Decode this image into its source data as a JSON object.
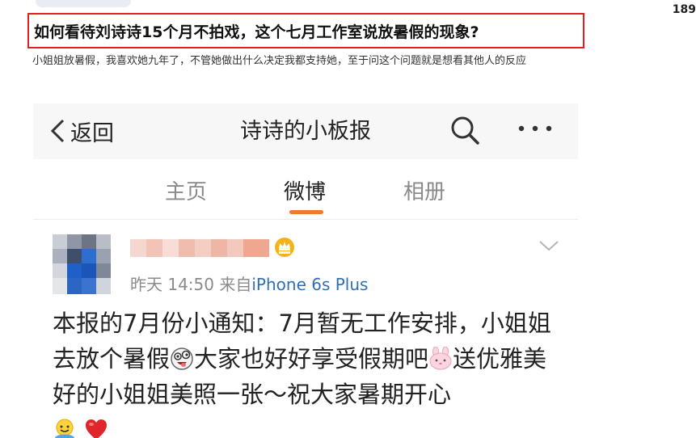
{
  "corner_count": "189",
  "question": {
    "title": "如何看待刘诗诗15个月不拍戏，这个七月工作室说放暑假的现象?",
    "answer": "小姐姐放暑假，我喜欢她九年了，不管她做出什么决定我都支持她，至于问这个问题就是想看其他人的反应"
  },
  "screenshot": {
    "nav": {
      "back_label": "返回",
      "title": "诗诗的小板报"
    },
    "tabs": [
      {
        "label": "主页",
        "active": false
      },
      {
        "label": "微博",
        "active": true
      },
      {
        "label": "相册",
        "active": false
      }
    ],
    "post": {
      "time": "昨天 14:50",
      "source_prefix": "来自",
      "source": "iPhone 6s Plus",
      "body_part1": "本报的7月份小通知：7月暂无工作安排，小姐姐去放个暑假",
      "body_part2": "大家也好好享受假期吧",
      "body_part3": "送优雅美好的小姐姐美照一张～祝大家暑期开心"
    }
  },
  "colors": {
    "highlight_border": "#e02020",
    "tab_underline": "#f07a2d",
    "source_link": "#2f6fb8",
    "heart": "#e0262a"
  }
}
